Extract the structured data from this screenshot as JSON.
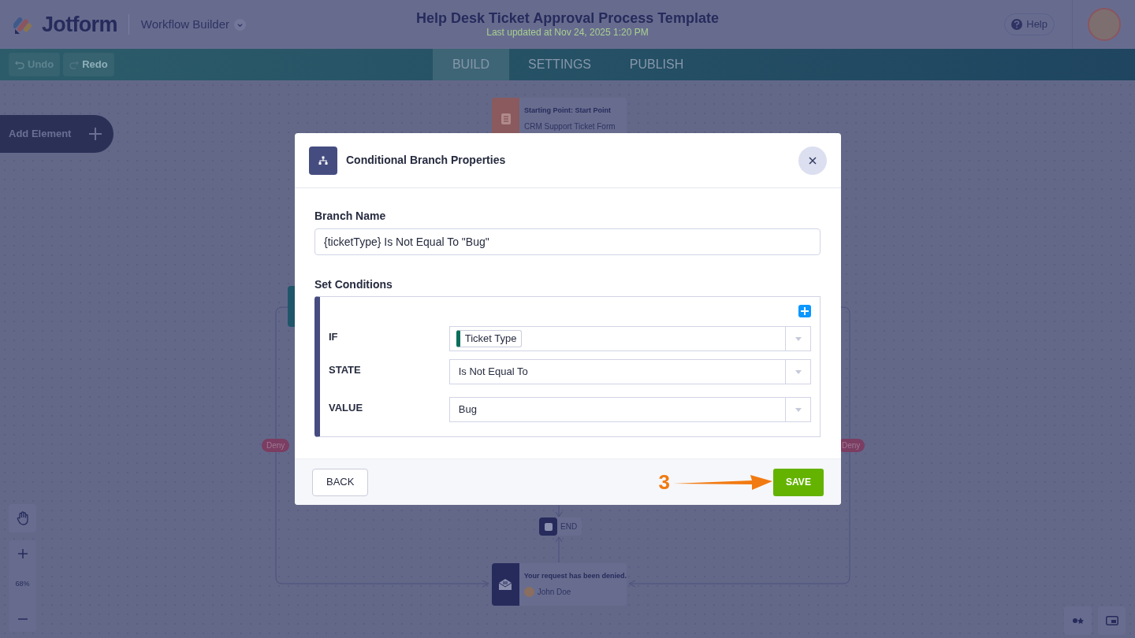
{
  "header": {
    "logo": "Jotform",
    "app_switcher": "Workflow Builder",
    "title": "Help Desk Ticket Approval Process Template",
    "subtitle": "Last updated at Nov 24, 2025 1:20 PM",
    "help": "Help"
  },
  "toolbar": {
    "undo": "Undo",
    "redo": "Redo",
    "tabs": [
      {
        "label": "BUILD",
        "selected": true
      },
      {
        "label": "SETTINGS",
        "selected": false
      },
      {
        "label": "PUBLISH",
        "selected": false
      }
    ]
  },
  "add_element": "Add Element",
  "canvas": {
    "start_node": {
      "title": "Starting Point: Start Point",
      "subtitle": "CRM Support Ticket Form"
    },
    "deny_labels": [
      "Deny",
      "Deny"
    ],
    "end_node": "END",
    "email_node": {
      "title": "Your request has been denied.",
      "assignee": "John Doe"
    }
  },
  "zoom": {
    "level_text": "68%"
  },
  "dialog": {
    "title": "Conditional Branch Properties",
    "branch_name_label": "Branch Name",
    "branch_name": "{ticketType} Is Not Equal To \"Bug\"",
    "conditions_label": "Set Conditions",
    "conditions": [
      {
        "label": "IF",
        "kind": "tag",
        "value": "Ticket Type"
      },
      {
        "label": "STATE",
        "kind": "text",
        "value": "Is Not Equal To"
      },
      {
        "label": "VALUE",
        "kind": "text",
        "value": "Bug"
      }
    ],
    "back": "BACK",
    "save": "SAVE"
  },
  "annotation": {
    "step": "3"
  }
}
